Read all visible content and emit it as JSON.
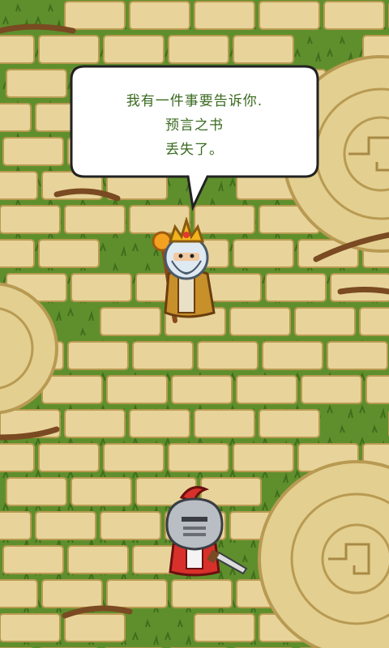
{
  "dialog": {
    "lines": [
      "我有一件事要告诉你.",
      "预言之书",
      "丢失了。"
    ]
  },
  "characters": {
    "king": {
      "name": "king-npc",
      "icon": "old-king-with-crown-and-staff"
    },
    "player": {
      "name": "player-knight",
      "icon": "knight-with-red-plume-helmet"
    }
  },
  "colors": {
    "grass": "#5a8a2a",
    "brick": "#e8d49a",
    "brick_edge": "#b89a52",
    "dialog_text": "#3a6a20",
    "dialog_bg": "#ffffff",
    "dialog_border": "#222222"
  }
}
